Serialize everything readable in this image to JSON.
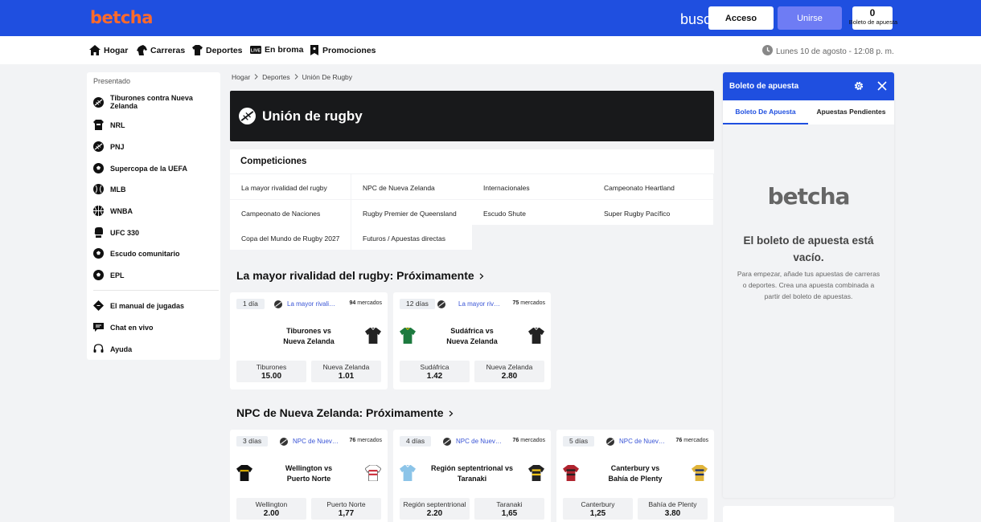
{
  "header": {
    "logo": "betcha",
    "search_text": "busc",
    "login_label": "Acceso",
    "join_label": "Unirse",
    "betslip_count": "0",
    "betslip_label": "Boleto de apuesta",
    "colors": {
      "primary": "#1f4fe0",
      "logo": "#ff6a2b",
      "join": "#6e7cf4"
    }
  },
  "nav": {
    "items": [
      {
        "label": "Hogar",
        "icon": "home-icon"
      },
      {
        "label": "Carreras",
        "icon": "horse-icon"
      },
      {
        "label": "Deportes",
        "icon": "jersey-icon"
      },
      {
        "label": "En broma",
        "icon": "live-icon",
        "badge": "LIVE"
      },
      {
        "label": "Promociones",
        "icon": "promo-icon"
      }
    ],
    "datetime": "Lunes 10 de agosto - 12:08 p. m."
  },
  "sidebar": {
    "title": "Presentado",
    "items": [
      {
        "label": "Tiburones contra Nueva Zelanda",
        "icon": "rugby-ball-icon"
      },
      {
        "label": "NRL",
        "icon": "nrl-icon"
      },
      {
        "label": "PNJ",
        "icon": "rugby-ball-icon"
      },
      {
        "label": "Supercopa de la UEFA",
        "icon": "soccer-ball-icon"
      },
      {
        "label": "MLB",
        "icon": "baseball-icon"
      },
      {
        "label": "WNBA",
        "icon": "basketball-icon"
      },
      {
        "label": "UFC 330",
        "icon": "glove-icon"
      },
      {
        "label": "Escudo comunitario",
        "icon": "soccer-ball-icon"
      },
      {
        "label": "EPL",
        "icon": "soccer-ball-icon"
      }
    ],
    "help_items": [
      {
        "label": "El manual de jugadas",
        "icon": "playbook-icon"
      },
      {
        "label": "Chat en vivo",
        "icon": "chat-icon"
      },
      {
        "label": "Ayuda",
        "icon": "headset-icon"
      }
    ]
  },
  "breadcrumb": [
    "Hogar",
    "Deportes",
    "Unión De Rugby"
  ],
  "hero_title": "Unión de rugby",
  "competitions": {
    "title": "Competiciones",
    "items": [
      "La mayor rivalidad del rugby",
      "NPC de Nueva Zelanda",
      "Internacionales",
      "Campeonato Heartland",
      "Campeonato de Naciones",
      "Rugby Premier de Queensland",
      "Escudo Shute",
      "Super Rugby Pacífico",
      "Copa del Mundo de Rugby 2027",
      "Futuros / Apuestas directas"
    ]
  },
  "sections": [
    {
      "title": "La mayor rivalidad del rugby: Próximamente",
      "cards": [
        {
          "days": "1 día",
          "competition": "La mayor rivalidad del rugby",
          "markets_num": "94",
          "markets_word": "mercados",
          "match_line1": "Tiburones vs",
          "match_line2": "Nueva Zelanda",
          "home_name": "Tiburones",
          "home_odd": "15.00",
          "away_name": "Nueva Zelanda",
          "away_odd": "1.01",
          "home_kit": "none",
          "away_kit": "#222222"
        },
        {
          "days": "12 días",
          "competition": "La mayor rivalidad del rugby",
          "markets_num": "75",
          "markets_word": "mercados",
          "match_line1": "Sudáfrica vs",
          "match_line2": "Nueva Zelanda",
          "home_name": "Sudáfrica",
          "home_odd": "1.42",
          "away_name": "Nueva Zelanda",
          "away_odd": "2.80",
          "home_kit": "#1d7a3f",
          "away_kit": "#222222"
        }
      ]
    },
    {
      "title": "NPC de Nueva Zelanda: Próximamente",
      "cards": [
        {
          "days": "3 días",
          "competition": "NPC de Nueva Zelanda",
          "markets_num": "76",
          "markets_word": "mercados",
          "match_line1": "Wellington vs",
          "match_line2": "Puerto Norte",
          "home_name": "Wellington",
          "home_odd": "2.00",
          "away_name": "Puerto Norte",
          "away_odd": "1,77",
          "home_kit": "#111111",
          "away_kit": "#ffffff"
        },
        {
          "days": "4 días",
          "competition": "NPC de Nueva Zelanda",
          "markets_num": "76",
          "markets_word": "mercados",
          "match_line1": "Región septentrional vs",
          "match_line2": "Taranaki",
          "home_name": "Región septentrional",
          "home_odd": "2.20",
          "away_name": "Taranaki",
          "away_odd": "1,65",
          "home_kit": "#8cc4e8",
          "away_kit": "#222222"
        },
        {
          "days": "5 días",
          "competition": "NPC de Nueva Zelanda",
          "markets_num": "76",
          "markets_word": "mercados",
          "match_line1": "Canterbury vs",
          "match_line2": "Bahía de Plenty",
          "home_name": "Canterbury",
          "home_odd": "1,25",
          "away_name": "Bahía de Plenty",
          "away_odd": "3.80",
          "home_kit": "#b0232e",
          "away_kit": "#e0b43a"
        }
      ]
    }
  ],
  "betslip": {
    "title": "Boleto de apuesta",
    "tab_active": "Boleto De Apuesta",
    "tab_other": "Apuestas Pendientes",
    "logo": "betcha",
    "empty_title": "El boleto de apuesta está vacío.",
    "empty_help": "Para empezar, añade tus apuestas de carreras o deportes. Crea una apuesta combinada a partir del boleto de apuestas."
  }
}
